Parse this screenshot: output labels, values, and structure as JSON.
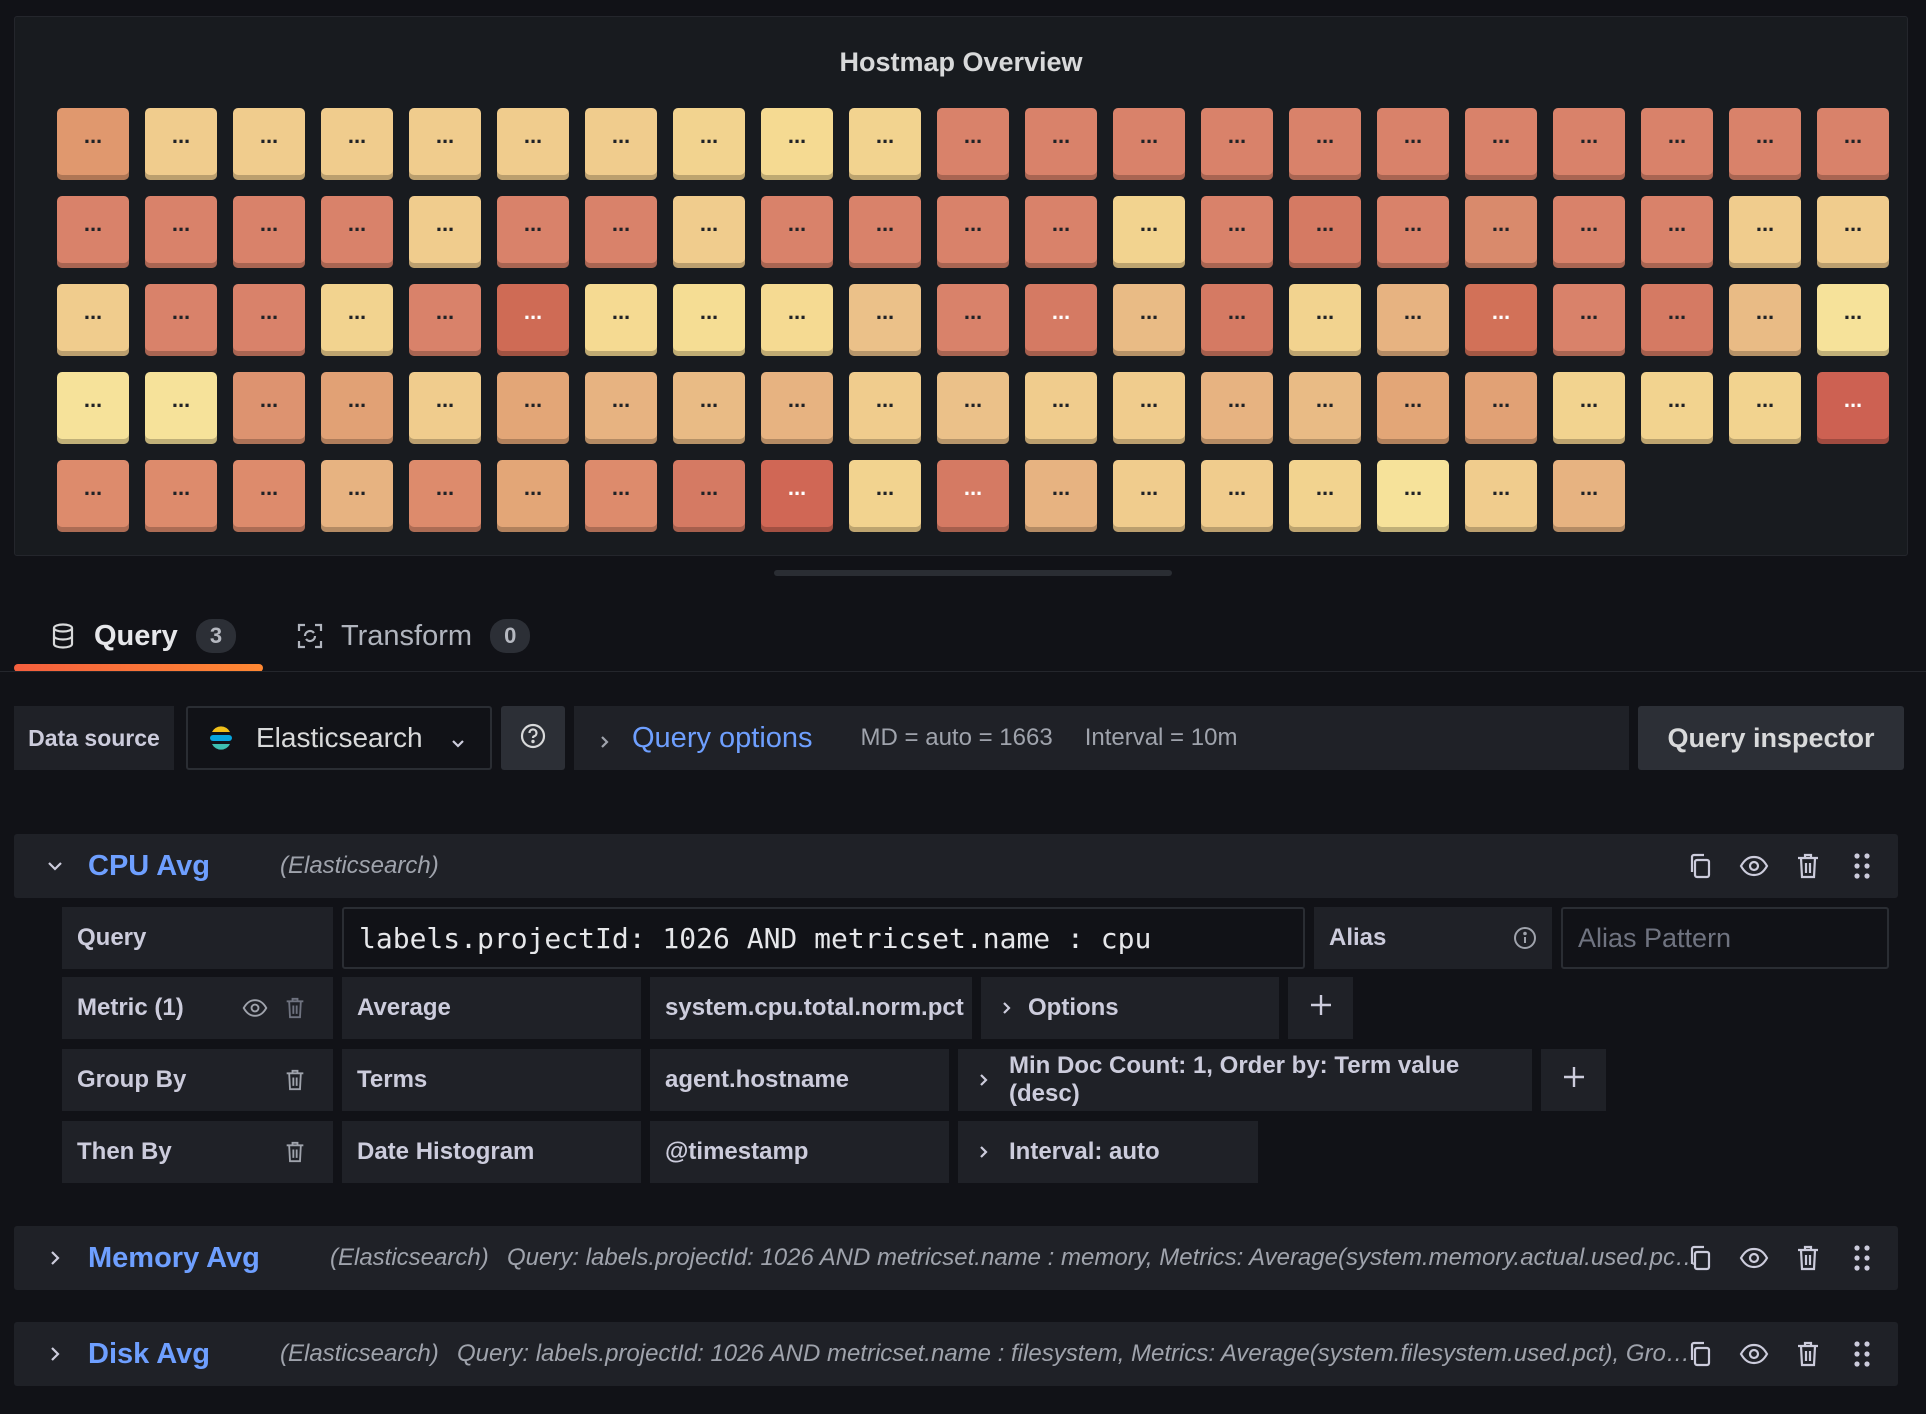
{
  "panel": {
    "title": "Hostmap Overview",
    "cell_text": "..."
  },
  "hostmap": {
    "rows": [
      [
        "#e0986e",
        "#f0cc8d",
        "#f0cc8d",
        "#f0cc8d",
        "#f0cc8d",
        "#f0cc8d",
        "#f0cc8d",
        "#f2d38f",
        "#f5da92",
        "#f2d38f",
        "#d9826a",
        "#d9826a",
        "#d9826a",
        "#d9826a",
        "#d9826a",
        "#d9826a",
        "#d9826a",
        "#d9826a",
        "#d9826a",
        "#d9826a",
        "#d9826a"
      ],
      [
        "#d9826a",
        "#d9826a",
        "#d9826a",
        "#d9826a",
        "#f0cc8d",
        "#d9826a",
        "#d9826a",
        "#f0cc8d",
        "#d9826a",
        "#d9826a",
        "#d9826a",
        "#d9826a",
        "#f2d38f",
        "#d9826a",
        "#d57a63",
        "#d9826a",
        "#d98a6c",
        "#d9826a",
        "#d9826a",
        "#f0cc8d",
        "#f0cc8d"
      ],
      [
        "#f0cc8d",
        "#d9826a",
        "#d9826a",
        "#f2d38f",
        "#d9826a",
        "#cf6b55",
        "#f5da92",
        "#f5dd94",
        "#f5da92",
        "#ebc189",
        "#d9826a",
        "#d57a63",
        "#e9bb85",
        "#d57a63",
        "#f2d38f",
        "#e7b381",
        "#d27158",
        "#d9826a",
        "#d57a63",
        "#e9bb85",
        "#f6e29a"
      ],
      [
        "#f6e29a",
        "#f6e29a",
        "#dd9370",
        "#e1a175",
        "#f0cc8d",
        "#e3a677",
        "#e7b381",
        "#e9bb85",
        "#e7b381",
        "#f0cc8d",
        "#ebc189",
        "#f0cc8d",
        "#f0cc8d",
        "#e7b381",
        "#e9bb85",
        "#e3a677",
        "#e1a175",
        "#f2d38f",
        "#f2d38f",
        "#f2d38f",
        "#cd6152"
      ],
      [
        "#dd8b6c",
        "#dd8b6c",
        "#dd8b6c",
        "#e7b381",
        "#dd8b6c",
        "#e3a677",
        "#dd8b6c",
        "#d57a63",
        "#d06755",
        "#f2d38f",
        "#d57a63",
        "#e7b381",
        "#f0cc8d",
        "#f0cc8d",
        "#f2d38f",
        "#f6e29a",
        "#f0cc8d",
        "#e7b381"
      ]
    ],
    "light_text_cells": [
      "2-5",
      "2-11",
      "2-16",
      "4-8",
      "4-10",
      "3-20"
    ]
  },
  "tabs": [
    {
      "label": "Query",
      "count": "3",
      "icon": "database-icon"
    },
    {
      "label": "Transform",
      "count": "0",
      "icon": "transform-icon"
    }
  ],
  "toolbar": {
    "data_source_label": "Data source",
    "data_source_value": "Elasticsearch",
    "query_options_label": "Query options",
    "md": "MD = auto = 1663",
    "interval": "Interval = 10m",
    "query_inspector_label": "Query inspector"
  },
  "queries": {
    "cpu": {
      "name": "CPU Avg",
      "datasource": "(Elasticsearch)",
      "query_label": "Query",
      "query_value": "labels.projectId: 1026 AND metricset.name : cpu",
      "alias_label": "Alias",
      "alias_placeholder": "Alias Pattern",
      "metric_label": "Metric (1)",
      "metric_type": "Average",
      "metric_field": "system.cpu.total.norm.pct",
      "metric_options": "Options",
      "groupby_label": "Group By",
      "groupby_type": "Terms",
      "groupby_field": "agent.hostname",
      "groupby_options": "Min Doc Count: 1, Order by: Term value (desc)",
      "thenby_label": "Then By",
      "thenby_type": "Date Histogram",
      "thenby_field": "@timestamp",
      "thenby_options": "Interval: auto"
    },
    "memory": {
      "name": "Memory Avg",
      "datasource": "(Elasticsearch)",
      "summary": "Query: labels.projectId: 1026 AND metricset.name : memory, Metrics: Average(system.memory.actual.used.pct), Group by: Terms(agent.hostname)"
    },
    "disk": {
      "name": "Disk Avg",
      "datasource": "(Elasticsearch)",
      "summary": "Query: labels.projectId: 1026 AND metricset.name : filesystem, Metrics: Average(system.filesystem.used.pct), Group by: Terms(agent.hostname)"
    }
  }
}
